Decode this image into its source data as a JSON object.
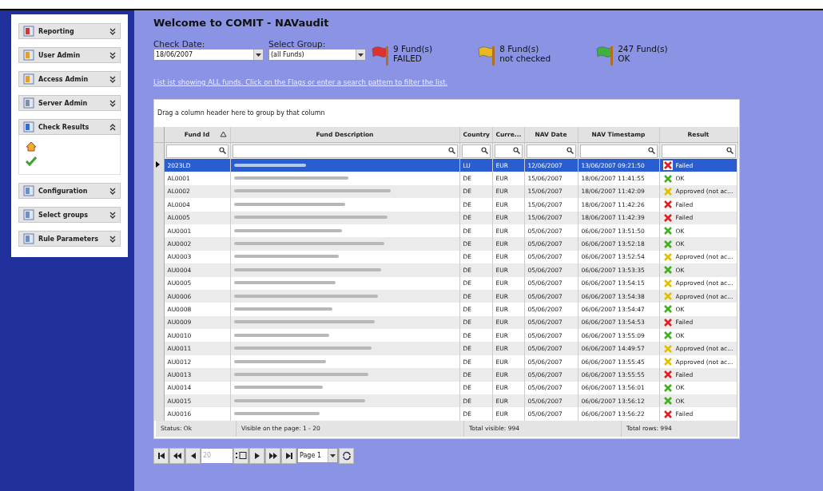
{
  "sidebar": {
    "items": [
      {
        "label": "Reporting",
        "expanded": false
      },
      {
        "label": "User Admin",
        "expanded": false
      },
      {
        "label": "Access Admin",
        "expanded": false
      },
      {
        "label": "Server Admin",
        "expanded": false
      },
      {
        "label": "Check Results",
        "expanded": true,
        "children": [
          {
            "kind": "home"
          },
          {
            "kind": "check"
          }
        ]
      },
      {
        "label": "Configuration",
        "expanded": false
      },
      {
        "label": "Select groups",
        "expanded": false
      },
      {
        "label": "Rule Parameters",
        "expanded": false
      }
    ]
  },
  "title": "Welcome to COMIT - NAVaudit",
  "check_date": {
    "label": "Check Date:",
    "value": "18/06/2007"
  },
  "select_group": {
    "label": "Select Group:",
    "value": "(all Funds)"
  },
  "flags": [
    {
      "color": "#e03030",
      "line1": "9 Fund(s)",
      "line2": "FAILED"
    },
    {
      "color": "#e8b820",
      "line1": "8 Fund(s)",
      "line2": "not checked"
    },
    {
      "color": "#40b040",
      "line1": "247 Fund(s)",
      "line2": "OK"
    }
  ],
  "info_link": "List ist showing ALL funds. Click on the Flags or enter a search pattern to filter the list.",
  "group_hint": "Drag a column header here to group by that column",
  "table": {
    "columns": [
      {
        "label": "Fund Id",
        "sorted": true
      },
      {
        "label": "Fund Description",
        "sorted": false
      },
      {
        "label": "Country",
        "sorted": false
      },
      {
        "label": "Curre...",
        "sorted": false
      },
      {
        "label": "NAV Date",
        "sorted": false
      },
      {
        "label": "NAV Timestamp",
        "sorted": false
      },
      {
        "label": "Result",
        "sorted": false
      }
    ],
    "rows": [
      {
        "id": "2023LD",
        "country": "LU",
        "currency": "EUR",
        "nav_date": "12/06/2007",
        "timestamp": "13/06/2007 09:21:50",
        "result": "Failed",
        "kind": "failed",
        "selected": true
      },
      {
        "id": "AL0001",
        "country": "DE",
        "currency": "EUR",
        "nav_date": "15/06/2007",
        "timestamp": "18/06/2007 11:41:55",
        "result": "OK",
        "kind": "ok",
        "selected": false
      },
      {
        "id": "AL0002",
        "country": "DE",
        "currency": "EUR",
        "nav_date": "15/06/2007",
        "timestamp": "18/06/2007 11:42:09",
        "result": "Approved (not ac...",
        "kind": "approved",
        "selected": false
      },
      {
        "id": "AL0004",
        "country": "DE",
        "currency": "EUR",
        "nav_date": "15/06/2007",
        "timestamp": "18/06/2007 11:42:26",
        "result": "Failed",
        "kind": "failed",
        "selected": false
      },
      {
        "id": "AL0005",
        "country": "DE",
        "currency": "EUR",
        "nav_date": "15/06/2007",
        "timestamp": "18/06/2007 11:42:39",
        "result": "Failed",
        "kind": "failed",
        "selected": false
      },
      {
        "id": "AU0001",
        "country": "DE",
        "currency": "EUR",
        "nav_date": "05/06/2007",
        "timestamp": "06/06/2007 13:51:50",
        "result": "OK",
        "kind": "ok",
        "selected": false
      },
      {
        "id": "AU0002",
        "country": "DE",
        "currency": "EUR",
        "nav_date": "05/06/2007",
        "timestamp": "06/06/2007 13:52:18",
        "result": "OK",
        "kind": "ok",
        "selected": false
      },
      {
        "id": "AU0003",
        "country": "DE",
        "currency": "EUR",
        "nav_date": "05/06/2007",
        "timestamp": "06/06/2007 13:52:54",
        "result": "Approved (not ac...",
        "kind": "approved",
        "selected": false
      },
      {
        "id": "AU0004",
        "country": "DE",
        "currency": "EUR",
        "nav_date": "05/06/2007",
        "timestamp": "06/06/2007 13:53:35",
        "result": "OK",
        "kind": "ok",
        "selected": false
      },
      {
        "id": "AU0005",
        "country": "DE",
        "currency": "EUR",
        "nav_date": "05/06/2007",
        "timestamp": "06/06/2007 13:54:15",
        "result": "Approved (not ac...",
        "kind": "approved",
        "selected": false
      },
      {
        "id": "AU0006",
        "country": "DE",
        "currency": "EUR",
        "nav_date": "05/06/2007",
        "timestamp": "06/06/2007 13:54:38",
        "result": "Approved (not ac...",
        "kind": "approved",
        "selected": false
      },
      {
        "id": "AU0008",
        "country": "DE",
        "currency": "EUR",
        "nav_date": "05/06/2007",
        "timestamp": "06/06/2007 13:54:47",
        "result": "OK",
        "kind": "ok",
        "selected": false
      },
      {
        "id": "AU0009",
        "country": "DE",
        "currency": "EUR",
        "nav_date": "05/06/2007",
        "timestamp": "06/06/2007 13:54:53",
        "result": "Failed",
        "kind": "failed",
        "selected": false
      },
      {
        "id": "AU0010",
        "country": "DE",
        "currency": "EUR",
        "nav_date": "05/06/2007",
        "timestamp": "06/06/2007 13:55:09",
        "result": "OK",
        "kind": "ok",
        "selected": false
      },
      {
        "id": "AU0011",
        "country": "DE",
        "currency": "EUR",
        "nav_date": "05/06/2007",
        "timestamp": "06/06/2007 14:49:57",
        "result": "Approved (not ac...",
        "kind": "approved",
        "selected": false
      },
      {
        "id": "AU0012",
        "country": "DE",
        "currency": "EUR",
        "nav_date": "05/06/2007",
        "timestamp": "06/06/2007 13:55:45",
        "result": "Approved (not ac...",
        "kind": "approved",
        "selected": false
      },
      {
        "id": "AU0013",
        "country": "DE",
        "currency": "EUR",
        "nav_date": "05/06/2007",
        "timestamp": "06/06/2007 13:55:55",
        "result": "Failed",
        "kind": "failed",
        "selected": false
      },
      {
        "id": "AU0014",
        "country": "DE",
        "currency": "EUR",
        "nav_date": "05/06/2007",
        "timestamp": "06/06/2007 13:56:01",
        "result": "OK",
        "kind": "ok",
        "selected": false
      },
      {
        "id": "AU0015",
        "country": "DE",
        "currency": "EUR",
        "nav_date": "05/06/2007",
        "timestamp": "06/06/2007 13:56:12",
        "result": "OK",
        "kind": "ok",
        "selected": false
      },
      {
        "id": "AU0016",
        "country": "DE",
        "currency": "EUR",
        "nav_date": "05/06/2007",
        "timestamp": "06/06/2007 13:56:22",
        "result": "Failed",
        "kind": "failed",
        "selected": false
      }
    ],
    "footer": [
      "Status: Ok",
      "Visible on the page: 1 - 20",
      "Total visible: 994",
      "Total rows: 994"
    ]
  },
  "pager": {
    "page_size": "20",
    "page": "Page 1"
  }
}
